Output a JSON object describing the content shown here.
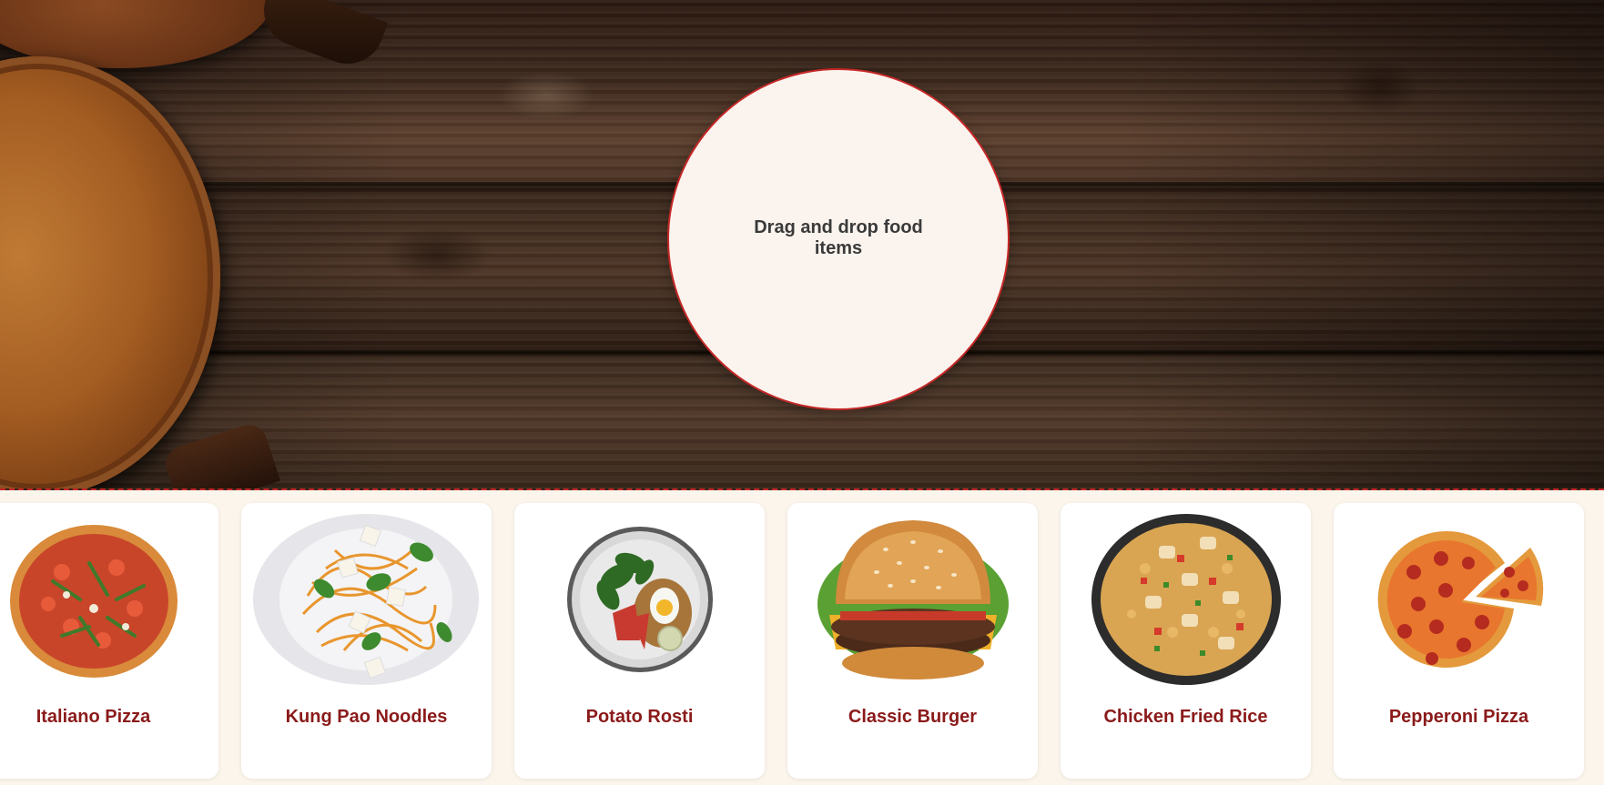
{
  "drop_zone": {
    "text": "Drag and drop food items"
  },
  "foods": [
    {
      "name": "Italiano Pizza",
      "icon": "italiano-pizza-icon"
    },
    {
      "name": "Kung Pao Noodles",
      "icon": "kung-pao-noodles-icon"
    },
    {
      "name": "Potato Rosti",
      "icon": "potato-rosti-icon"
    },
    {
      "name": "Classic Burger",
      "icon": "classic-burger-icon"
    },
    {
      "name": "Chicken Fried Rice",
      "icon": "chicken-fried-rice-icon"
    },
    {
      "name": "Pepperoni Pizza",
      "icon": "pepperoni-pizza-icon"
    }
  ],
  "colors": {
    "accent": "#c62828",
    "label": "#8b1a1a",
    "page_background": "#fbf5ec",
    "drop_zone_fill": "#fbf4ee"
  }
}
